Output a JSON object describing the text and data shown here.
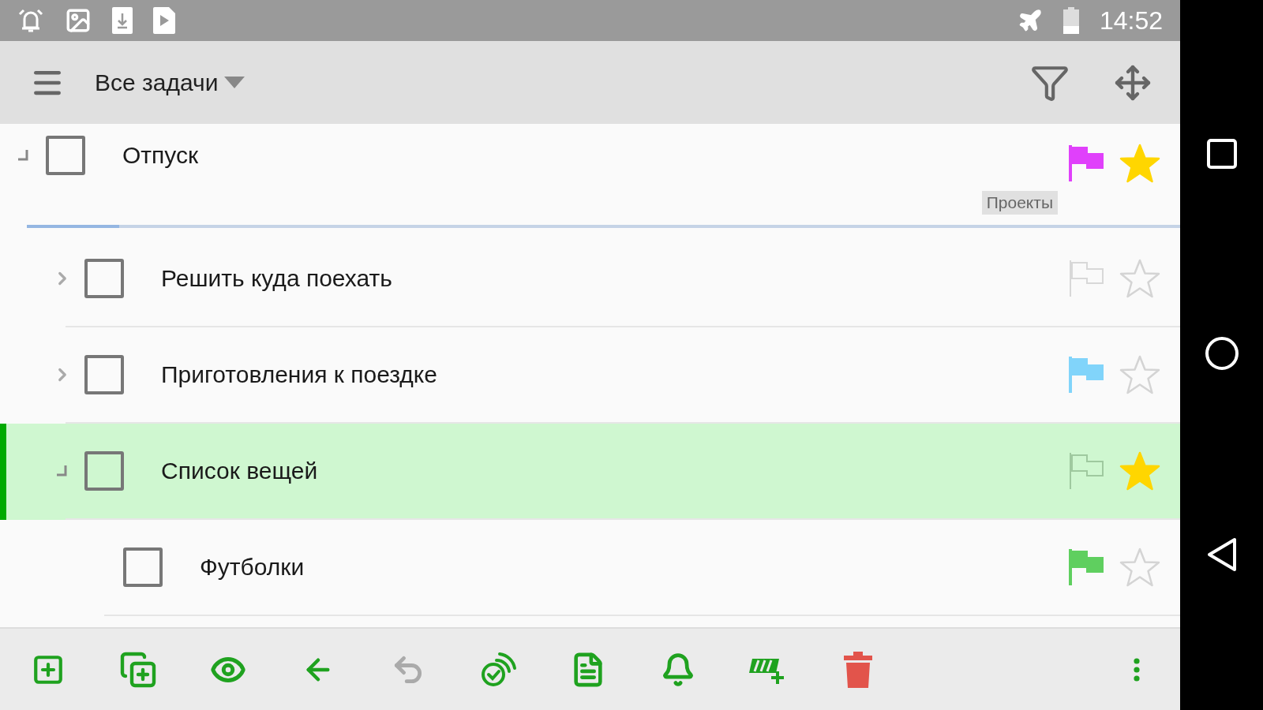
{
  "status_bar": {
    "time": "14:52"
  },
  "app_bar": {
    "title": "Все задачи"
  },
  "tasks": [
    {
      "title": "Отпуск",
      "checked": false,
      "expanded": true,
      "selected": false,
      "color": "#e040fb",
      "starred": true,
      "tag": "Проекты",
      "level": 0.08,
      "children": [
        {
          "title": "Решить куда поехать",
          "checked": false,
          "expanded": false,
          "selected": false,
          "starred": false
        },
        {
          "title": "Приготовления к поездке",
          "checked": false,
          "expanded": false,
          "selected": false,
          "color": "#81d4fa",
          "starred": false
        },
        {
          "title": "Список вещей",
          "checked": false,
          "expanded": true,
          "selected": true,
          "starred": true,
          "children": [
            {
              "title": "Футболки",
              "checked": false,
              "selected": false,
              "color": "#5fcf5f",
              "starred": false
            }
          ]
        }
      ]
    }
  ],
  "toolbar": [
    {
      "disabled": false
    },
    {
      "disabled": false
    },
    {
      "disabled": false
    },
    {
      "disabled": false
    },
    {
      "disabled": true
    },
    {
      "disabled": false
    },
    {
      "disabled": false
    },
    {
      "disabled": false
    },
    {
      "disabled": false
    },
    {
      "disabled": false
    },
    {
      "disabled": false
    }
  ]
}
